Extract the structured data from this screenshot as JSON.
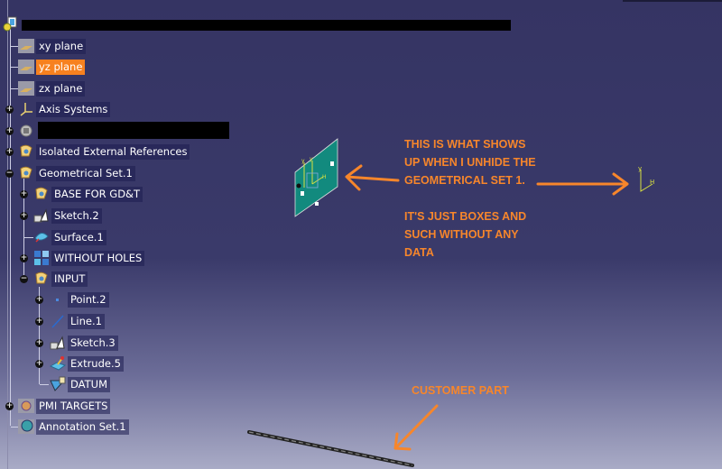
{
  "tree": {
    "root": {
      "label": "",
      "redacted": true,
      "icon": "part-icon"
    },
    "items": [
      {
        "label": "xy plane",
        "icon": "plane-icon"
      },
      {
        "label": "yz plane",
        "icon": "plane-icon",
        "selected": true
      },
      {
        "label": "zx plane",
        "icon": "plane-icon"
      },
      {
        "label": "Axis Systems",
        "icon": "axis-system-icon"
      },
      {
        "label": "",
        "icon": "body-icon",
        "redacted": true
      },
      {
        "label": "Isolated External References",
        "icon": "geometrical-set-icon"
      },
      {
        "label": "Geometrical Set.1",
        "icon": "geometrical-set-icon"
      },
      {
        "label": "BASE FOR GD&T",
        "icon": "geometrical-set-icon"
      },
      {
        "label": "Sketch.2",
        "icon": "sketch-icon"
      },
      {
        "label": "Surface.1",
        "icon": "surface-icon"
      },
      {
        "label": "WITHOUT HOLES",
        "icon": "multi-result-icon"
      },
      {
        "label": "INPUT",
        "icon": "geometrical-set-icon"
      },
      {
        "label": "Point.2",
        "icon": "point-icon"
      },
      {
        "label": "Line.1",
        "icon": "line-icon"
      },
      {
        "label": "Sketch.3",
        "icon": "sketch-icon"
      },
      {
        "label": "Extrude.5",
        "icon": "extrude-icon"
      },
      {
        "label": "DATUM",
        "icon": "datum-icon"
      },
      {
        "label": "PMI TARGETS",
        "icon": "pmi-icon"
      },
      {
        "label": "Annotation Set.1",
        "icon": "annotation-set-icon"
      }
    ]
  },
  "annotations": {
    "note1": [
      "THIS IS WHAT SHOWS",
      "UP WHEN I UNHIDE THE",
      "GEOMETRICAL SET 1."
    ],
    "note2": [
      "IT'S JUST BOXES AND",
      "SUCH WITHOUT ANY",
      "DATA"
    ],
    "note3": "CUSTOMER PART",
    "accent_color": "#f7862b"
  },
  "axis_labels": {
    "y": "y",
    "h": "H"
  }
}
